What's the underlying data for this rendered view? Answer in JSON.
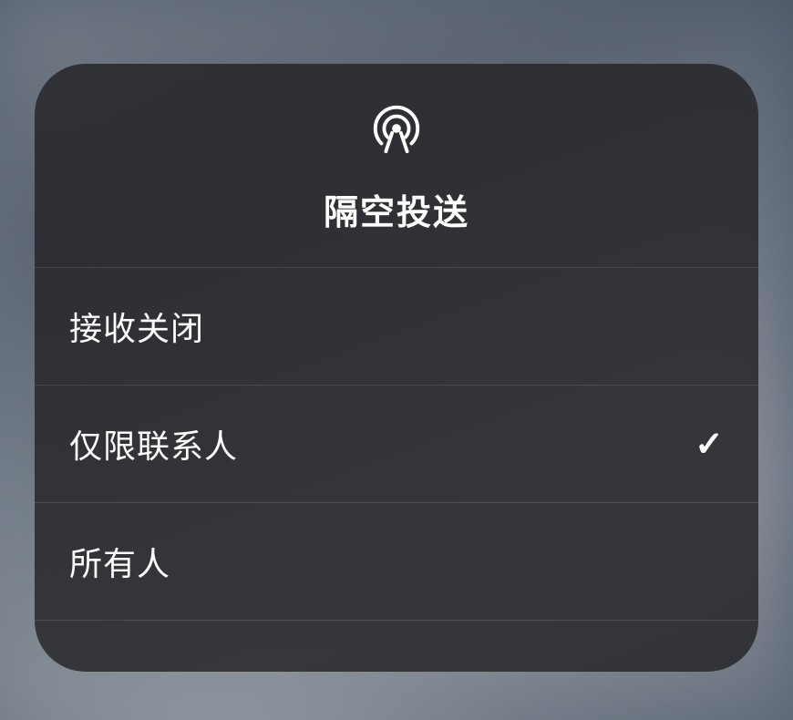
{
  "modal": {
    "title": "隔空投送",
    "icon_name": "airdrop",
    "options": [
      {
        "label": "接收关闭",
        "selected": false
      },
      {
        "label": "仅限联系人",
        "selected": true
      },
      {
        "label": "所有人",
        "selected": false
      }
    ]
  }
}
